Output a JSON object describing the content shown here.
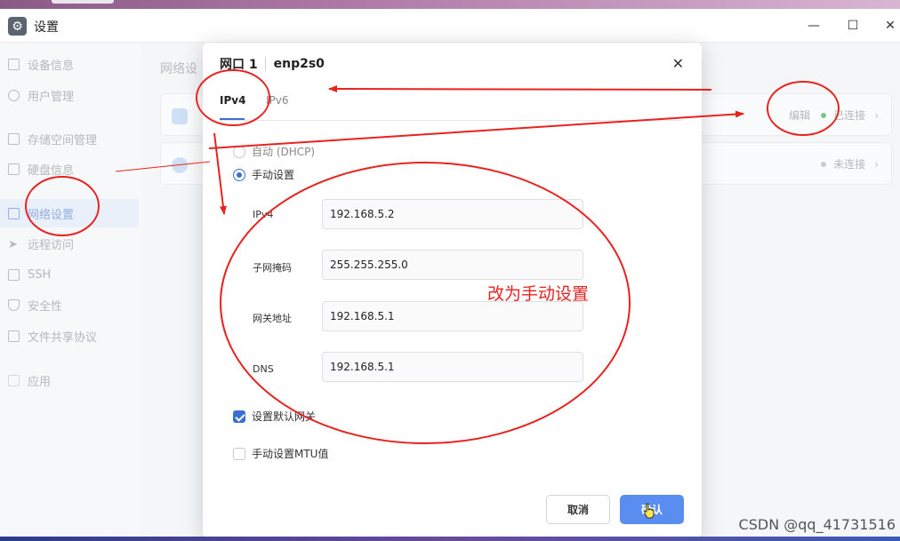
{
  "window": {
    "title": "设置",
    "app_icon": "gear-icon"
  },
  "sidebar": {
    "items": [
      {
        "label": "设备信息",
        "icon": "device-icon"
      },
      {
        "label": "用户管理",
        "icon": "user-icon"
      },
      {
        "label": "存储空间管理",
        "icon": "storage-icon"
      },
      {
        "label": "硬盘信息",
        "icon": "disk-icon"
      },
      {
        "label": "网络设置",
        "icon": "network-icon",
        "active": true
      },
      {
        "label": "远程访问",
        "icon": "send-icon"
      },
      {
        "label": "SSH",
        "icon": "terminal-icon"
      },
      {
        "label": "安全性",
        "icon": "shield-icon"
      },
      {
        "label": "文件共享协议",
        "icon": "file-icon"
      },
      {
        "label": "应用",
        "icon": "apps-icon"
      }
    ]
  },
  "main": {
    "title": "网络设",
    "cards": [
      {
        "edit_label": "编辑",
        "status": "已连接",
        "status_color": "#7cc58a"
      },
      {
        "status": "未连接",
        "status_color": "#c9cccf"
      }
    ]
  },
  "dialog": {
    "title_port": "网口 1",
    "title_iface": "enp2s0",
    "tabs": [
      {
        "label": "IPv4",
        "active": true
      },
      {
        "label": "IPv6"
      }
    ],
    "mode_options": [
      {
        "label": "自动 (DHCP)",
        "selected": false
      },
      {
        "label": "手动设置",
        "selected": true
      }
    ],
    "fields": [
      {
        "label": "IPv4",
        "value": "192.168.5.2"
      },
      {
        "label": "子网掩码",
        "value": "255.255.255.0"
      },
      {
        "label": "网关地址",
        "value": "192.168.5.1"
      },
      {
        "label": "DNS",
        "value": "192.168.5.1"
      }
    ],
    "checkboxes": [
      {
        "label": "设置默认网关",
        "checked": true
      },
      {
        "label": "手动设置MTU值",
        "checked": false
      }
    ],
    "cancel_label": "取消",
    "ok_label": "确认"
  },
  "annotation": {
    "text": "改为手动设置",
    "color": "#e8231f"
  },
  "watermark": "CSDN @qq_41731516"
}
